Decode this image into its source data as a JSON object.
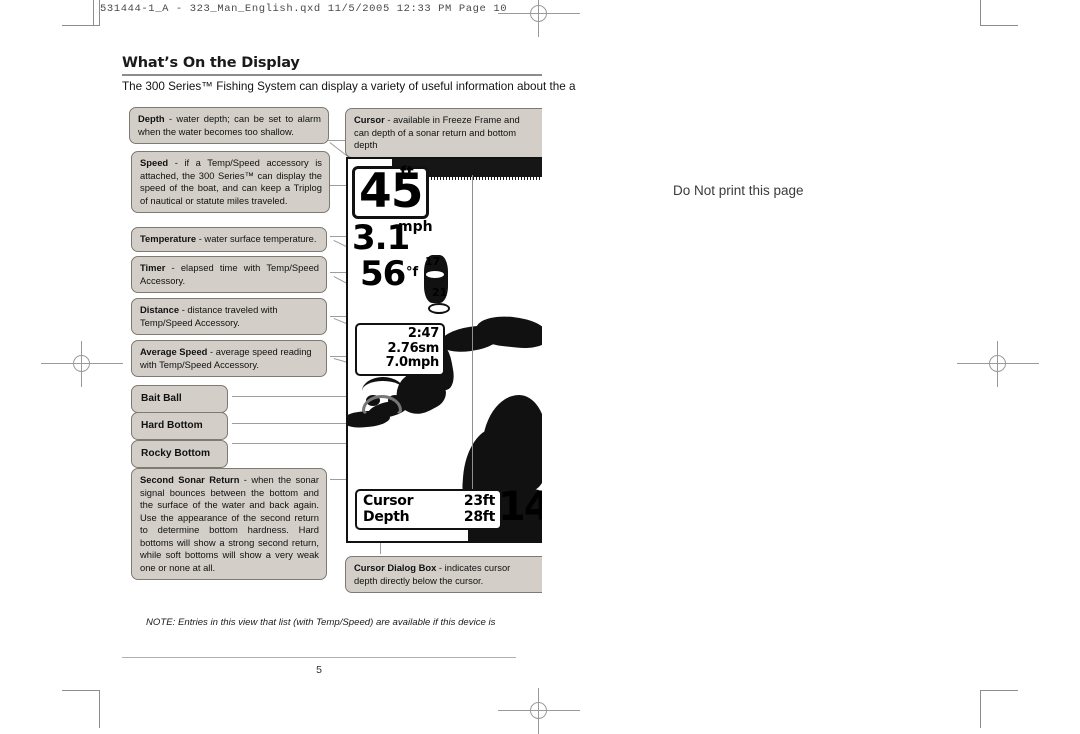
{
  "proof": {
    "header_bar": "531444-1_A - 323_Man_English.qxd  11/5/2005  12:33 PM  Page 10",
    "watermark": "Do Not print this page"
  },
  "document": {
    "heading": "What’s On the Display",
    "intro": "The 300 Series™ Fishing System can display a variety of useful information about the a",
    "note": "NOTE: Entries in this view that list (with Temp/Speed) are available if this device is",
    "page_number": "5"
  },
  "callouts": {
    "left": [
      {
        "term": "Depth",
        "text": " - water depth; can be set to alarm when the water becomes too shallow."
      },
      {
        "term": "Speed",
        "text": " - if a Temp/Speed accessory is attached, the 300 Series™ can display the speed of the boat, and can keep a Triplog of nautical or statute miles traveled."
      },
      {
        "term": "Temperature",
        "text": " - water surface temperature."
      },
      {
        "term": "Timer",
        "text": " - elapsed time with Temp/Speed Accessory."
      },
      {
        "term": "Distance",
        "text": " - distance traveled with Temp/Speed Accessory."
      },
      {
        "term": "Average Speed",
        "text": " - average speed reading with Temp/Speed Accessory."
      },
      {
        "term": "Bait Ball",
        "text": ""
      },
      {
        "term": "Hard Bottom",
        "text": ""
      },
      {
        "term": "Rocky Bottom",
        "text": ""
      },
      {
        "term": "Second Sonar Return",
        "text": " - when the sonar signal bounces between the bottom and the surface of the water and back again. Use the appearance of the second return to determine bottom hardness. Hard bottoms will show a strong second return, while soft bottoms will show a very weak one or none at all."
      }
    ],
    "right": [
      {
        "term": "Cursor",
        "text": " - available in Freeze Frame and can depth of a sonar return and bottom depth"
      },
      {
        "term": "Cursor Dialog Box",
        "text": " - indicates cursor depth directly below the cursor."
      }
    ]
  },
  "sonar_display": {
    "depth_value": "45",
    "depth_unit": "ft",
    "speed_value": "3.1",
    "speed_unit": "mph",
    "temp_value": "56",
    "temp_unit": "°f",
    "triplog": {
      "timer": "2:47",
      "distance": "2.76sm",
      "average_speed": "7.0mph"
    },
    "cursor_dialog": {
      "cursor_label": "Cursor",
      "cursor_value": "23ft",
      "depth_label": "Depth",
      "depth_value": "28ft"
    },
    "big_cursor_depth": "14",
    "fish_labels": [
      "17",
      "21"
    ]
  },
  "colors": {
    "callout_fill": "#d3cfc8",
    "callout_border": "#7d7a74",
    "leader": "#9d9d9d",
    "rule": "#8c8c8c",
    "sonar_ink": "#111111"
  }
}
